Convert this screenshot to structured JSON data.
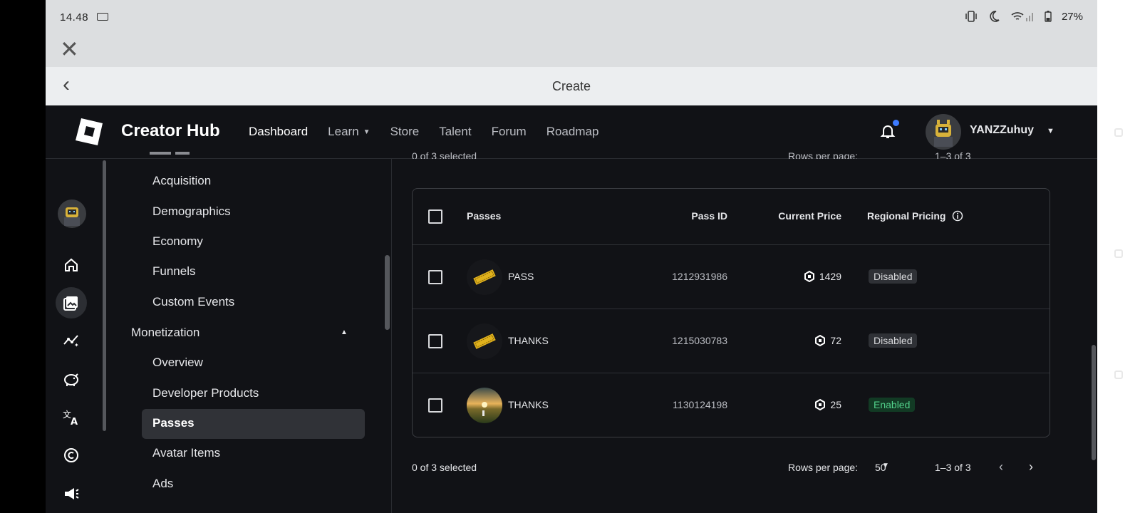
{
  "status": {
    "time": "14.48",
    "battery": "27%"
  },
  "browser": {
    "title": "Create"
  },
  "nav": {
    "brand": "Creator Hub",
    "links": [
      {
        "label": "Dashboard",
        "active": true
      },
      {
        "label": "Learn",
        "dropdown": true
      },
      {
        "label": "Store"
      },
      {
        "label": "Talent"
      },
      {
        "label": "Forum"
      },
      {
        "label": "Roadmap"
      }
    ],
    "username": "YANZZuhuy",
    "notification_dot": true
  },
  "rail": {
    "icons": [
      "home-icon",
      "image-icon",
      "analytics-icon",
      "piggy-bank-icon",
      "translate-icon",
      "copyright-icon",
      "megaphone-icon"
    ],
    "selected": "image-icon"
  },
  "menu": {
    "items_top": [
      "Acquisition",
      "Demographics",
      "Economy",
      "Funnels",
      "Custom Events"
    ],
    "section": "Monetization",
    "items_bottom": [
      "Overview",
      "Developer Products",
      "Passes",
      "Avatar Items",
      "Ads"
    ],
    "selected": "Passes"
  },
  "table": {
    "headers": {
      "select": "",
      "passes": "Passes",
      "pass_id": "Pass ID",
      "price": "Current Price",
      "regional": "Regional Pricing"
    },
    "rows": [
      {
        "name": "PASS",
        "id": "1212931986",
        "price": "1429",
        "regional": "Disabled",
        "thumb": "ticket"
      },
      {
        "name": "THANKS",
        "id": "1215030783",
        "price": "72",
        "regional": "Disabled",
        "thumb": "ticket"
      },
      {
        "name": "THANKS",
        "id": "1130124198",
        "price": "25",
        "regional": "Enabled",
        "thumb": "sunset"
      }
    ]
  },
  "footer": {
    "selected_text": "0 of 3 selected",
    "rows_label": "Rows per page:",
    "rows_value": "50",
    "range": "1–3 of 3"
  },
  "colors": {
    "accent_blue": "#3d7bff",
    "enabled_green": "#52d08a",
    "background": "#111216"
  }
}
